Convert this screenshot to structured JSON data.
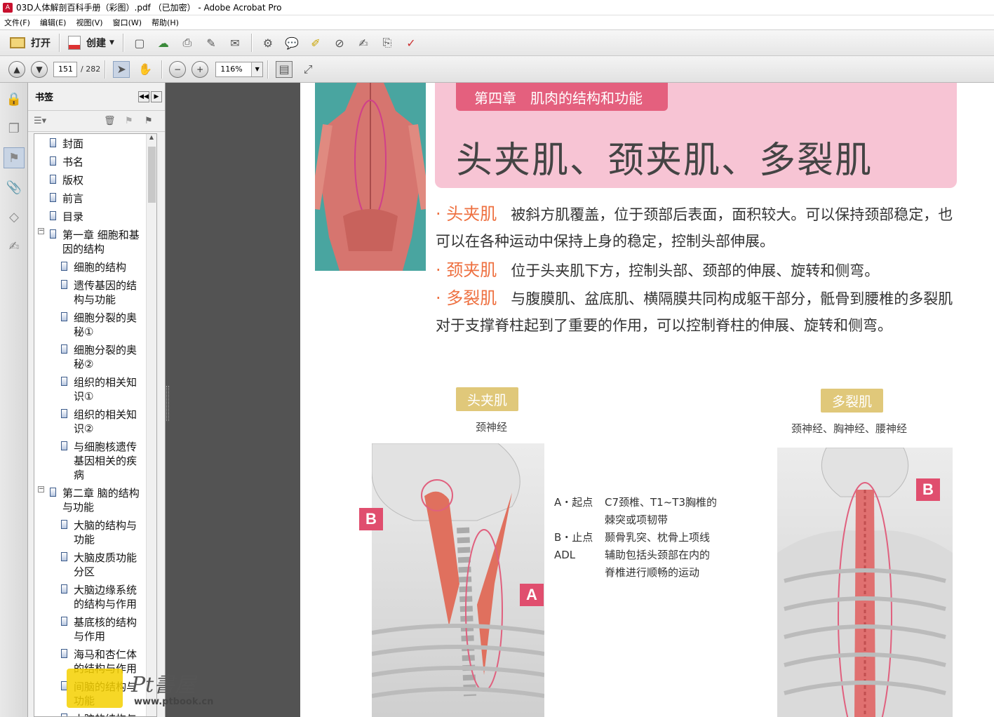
{
  "window": {
    "title": "03D人体解剖百科手册（彩图）.pdf （已加密） - Adobe Acrobat Pro"
  },
  "menu": [
    "文件(F)",
    "编辑(E)",
    "视图(V)",
    "窗口(W)",
    "帮助(H)"
  ],
  "toolbar": {
    "open_label": "打开",
    "create_label": "创建"
  },
  "nav": {
    "page_current": "151",
    "page_total": "/ 282",
    "zoom": "116%"
  },
  "panel": {
    "title": "书签"
  },
  "bookmarks": [
    {
      "label": "封面",
      "level": 0,
      "expander": ""
    },
    {
      "label": "书名",
      "level": 0,
      "expander": ""
    },
    {
      "label": "版权",
      "level": 0,
      "expander": ""
    },
    {
      "label": "前言",
      "level": 0,
      "expander": ""
    },
    {
      "label": "目录",
      "level": 0,
      "expander": ""
    },
    {
      "label": "第一章 细胞和基因的结构",
      "level": 0,
      "expander": "−"
    },
    {
      "label": "细胞的结构",
      "level": 1,
      "expander": ""
    },
    {
      "label": "遗传基因的结构与功能",
      "level": 1,
      "expander": ""
    },
    {
      "label": "细胞分裂的奥秘①",
      "level": 1,
      "expander": ""
    },
    {
      "label": "细胞分裂的奥秘②",
      "level": 1,
      "expander": ""
    },
    {
      "label": "组织的相关知识①",
      "level": 1,
      "expander": ""
    },
    {
      "label": "组织的相关知识②",
      "level": 1,
      "expander": ""
    },
    {
      "label": "与细胞核遗传基因相关的疾病",
      "level": 1,
      "expander": ""
    },
    {
      "label": "第二章 脑的结构与功能",
      "level": 0,
      "expander": "−"
    },
    {
      "label": "大脑的结构与功能",
      "level": 1,
      "expander": ""
    },
    {
      "label": "大脑皮质功能分区",
      "level": 1,
      "expander": ""
    },
    {
      "label": "大脑边缘系统的结构与作用",
      "level": 1,
      "expander": ""
    },
    {
      "label": "基底核的结构与作用",
      "level": 1,
      "expander": ""
    },
    {
      "label": "海马和杏仁体的结构与作用",
      "level": 1,
      "expander": ""
    },
    {
      "label": "间脑的结构与功能",
      "level": 1,
      "expander": ""
    },
    {
      "label": "小脑的结构与",
      "level": 1,
      "expander": ""
    }
  ],
  "document": {
    "chapter": "第四章　肌肉的结构和功能",
    "title": "头夹肌、颈夹肌、多裂肌",
    "para1_kw": "· 头夹肌",
    "para1_text": "被斜方肌覆盖，位于颈部后表面，面积较大。可以保持颈部稳定，也可以在各种运动中保持上身的稳定，控制头部伸展。",
    "para2_kw": "· 颈夹肌",
    "para2_text": "位于头夹肌下方，控制头部、颈部的伸展、旋转和侧弯。",
    "para3_kw": "· 多裂肌",
    "para3_text": "与腹膜肌、盆底肌、横隔膜共同构成躯干部分，骶骨到腰椎的多裂肌对于支撑脊柱起到了重要的作用，可以控制脊柱的伸展、旋转和侧弯。",
    "left_label": "头夹肌",
    "left_nerve": "颈神经",
    "right_label": "多裂肌",
    "right_nerve": "颈神经、胸神经、腰神经",
    "legend": [
      {
        "k": "A・起点",
        "v": "C7颈椎、T1~T3胸椎的"
      },
      {
        "k": "",
        "v": "棘突或项韧带"
      },
      {
        "k": "B・止点",
        "v": "颞骨乳突、枕骨上项线"
      },
      {
        "k": "ADL",
        "v": "辅助包括头颈部在内的"
      },
      {
        "k": "",
        "v": "脊椎进行顺畅的运动"
      }
    ],
    "marker_a": "A",
    "marker_b": "B",
    "marker_b2": "B"
  },
  "watermark": {
    "text": "Pt書屋",
    "url": "www.ptbook.cn"
  }
}
